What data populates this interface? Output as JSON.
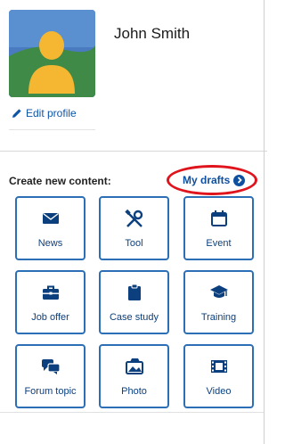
{
  "profile": {
    "name": "John Smith",
    "edit_label": "Edit profile"
  },
  "create": {
    "title": "Create new content:",
    "drafts_label": "My drafts"
  },
  "tiles": [
    {
      "label": "News",
      "icon": "envelope-icon"
    },
    {
      "label": "Tool",
      "icon": "tools-icon"
    },
    {
      "label": "Event",
      "icon": "calendar-icon"
    },
    {
      "label": "Job offer",
      "icon": "briefcase-icon"
    },
    {
      "label": "Case study",
      "icon": "clipboard-icon"
    },
    {
      "label": "Training",
      "icon": "graduation-cap-icon"
    },
    {
      "label": "Forum topic",
      "icon": "chat-bubbles-icon"
    },
    {
      "label": "Photo",
      "icon": "photo-icon"
    },
    {
      "label": "Video",
      "icon": "film-icon"
    }
  ],
  "colors": {
    "accent": "#2d6fb6",
    "link": "#0e55a6",
    "highlight_ring": "#e0141c"
  }
}
